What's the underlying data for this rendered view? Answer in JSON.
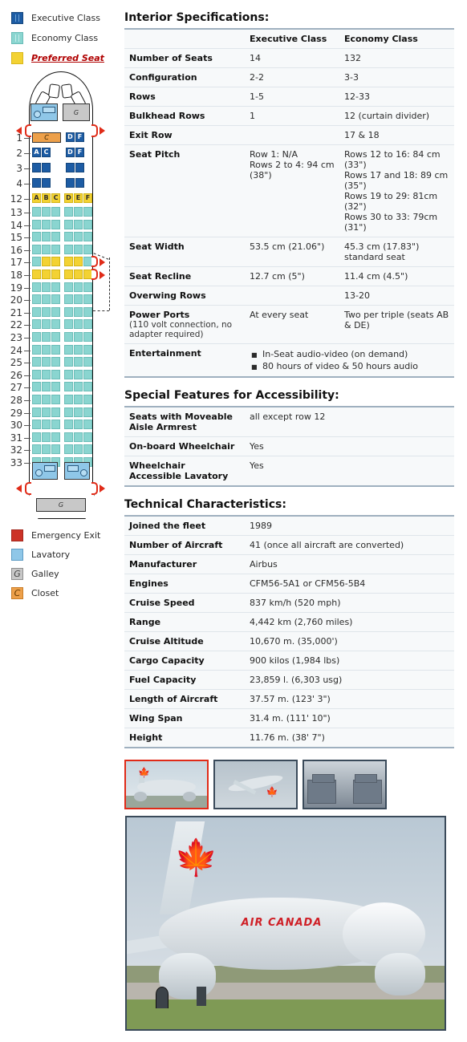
{
  "seatmap": {
    "legend_top": [
      {
        "key": "executive",
        "label": "Executive Class",
        "color": "#1d5ca4"
      },
      {
        "key": "economy",
        "label": "Economy Class",
        "color": "#8ad5d0"
      },
      {
        "key": "preferred",
        "label": "Preferred Seat",
        "color": "#f3d233"
      }
    ],
    "legend_bottom": [
      {
        "key": "emergency-exit",
        "label": "Emergency Exit",
        "color": "#cc3327",
        "glyph": ""
      },
      {
        "key": "lavatory",
        "label": "Lavatory",
        "color": "#8fc7e8",
        "glyph": ""
      },
      {
        "key": "galley",
        "label": "Galley",
        "color": "#c8c8c8",
        "glyph": "G"
      },
      {
        "key": "closet",
        "label": "Closet",
        "color": "#eda04a",
        "glyph": "C"
      }
    ],
    "front_lavatory_label": "",
    "front_galley_label": "G",
    "front_closet_label": "C",
    "rear_galley_label": "G",
    "seat_letters_left": "A B C",
    "seat_letters_right": "D E F",
    "rows": [
      {
        "num": "1",
        "class": "exec",
        "left": [
          "closet"
        ],
        "right": [
          "D",
          "F"
        ]
      },
      {
        "num": "2",
        "class": "exec",
        "left": [
          "A",
          "C"
        ],
        "right": [
          "D",
          "F"
        ]
      },
      {
        "num": "3",
        "class": "exec",
        "left": [
          "A",
          "C"
        ],
        "right": [
          "D",
          "F"
        ]
      },
      {
        "num": "4",
        "class": "exec",
        "left": [
          "A",
          "C"
        ],
        "right": [
          "D",
          "F"
        ]
      },
      {
        "num": "12",
        "class": "pref",
        "left": [
          "A",
          "B",
          "C"
        ],
        "right": [
          "D",
          "E",
          "F"
        ],
        "letters": true
      },
      {
        "num": "13",
        "class": "econ",
        "left": [
          "A",
          "B",
          "C"
        ],
        "right": [
          "D",
          "E",
          "F"
        ]
      },
      {
        "num": "14",
        "class": "econ",
        "left": [
          "A",
          "B",
          "C"
        ],
        "right": [
          "D",
          "E",
          "F"
        ]
      },
      {
        "num": "15",
        "class": "econ",
        "left": [
          "A",
          "B",
          "C"
        ],
        "right": [
          "D",
          "E",
          "F"
        ]
      },
      {
        "num": "16",
        "class": "econ",
        "left": [
          "A",
          "B",
          "C"
        ],
        "right": [
          "D",
          "E",
          "F"
        ]
      },
      {
        "num": "17",
        "class": "mixed",
        "left": [
          "A",
          "B",
          "C"
        ],
        "right": [
          "D",
          "E",
          "F"
        ],
        "exit": true
      },
      {
        "num": "18",
        "class": "pref",
        "left": [
          "A",
          "B",
          "C"
        ],
        "right": [
          "D",
          "E",
          "F"
        ],
        "exit": true
      },
      {
        "num": "19",
        "class": "econ",
        "left": [
          "A",
          "B",
          "C"
        ],
        "right": [
          "D",
          "E",
          "F"
        ]
      },
      {
        "num": "20",
        "class": "econ",
        "left": [
          "A",
          "B",
          "C"
        ],
        "right": [
          "D",
          "E",
          "F"
        ]
      },
      {
        "num": "21",
        "class": "econ",
        "left": [
          "A",
          "B",
          "C"
        ],
        "right": [
          "D",
          "E",
          "F"
        ]
      },
      {
        "num": "22",
        "class": "econ",
        "left": [
          "A",
          "B",
          "C"
        ],
        "right": [
          "D",
          "E",
          "F"
        ]
      },
      {
        "num": "23",
        "class": "econ",
        "left": [
          "A",
          "B",
          "C"
        ],
        "right": [
          "D",
          "E",
          "F"
        ]
      },
      {
        "num": "24",
        "class": "econ",
        "left": [
          "A",
          "B",
          "C"
        ],
        "right": [
          "D",
          "E",
          "F"
        ]
      },
      {
        "num": "25",
        "class": "econ",
        "left": [
          "A",
          "B",
          "C"
        ],
        "right": [
          "D",
          "E",
          "F"
        ]
      },
      {
        "num": "26",
        "class": "econ",
        "left": [
          "A",
          "B",
          "C"
        ],
        "right": [
          "D",
          "E",
          "F"
        ]
      },
      {
        "num": "27",
        "class": "econ",
        "left": [
          "A",
          "B",
          "C"
        ],
        "right": [
          "D",
          "E",
          "F"
        ]
      },
      {
        "num": "28",
        "class": "econ",
        "left": [
          "A",
          "B",
          "C"
        ],
        "right": [
          "D",
          "E",
          "F"
        ]
      },
      {
        "num": "29",
        "class": "econ",
        "left": [
          "A",
          "B",
          "C"
        ],
        "right": [
          "D",
          "E",
          "F"
        ]
      },
      {
        "num": "30",
        "class": "econ",
        "left": [
          "A",
          "B",
          "C"
        ],
        "right": [
          "D",
          "E",
          "F"
        ]
      },
      {
        "num": "31",
        "class": "econ",
        "left": [
          "A",
          "B",
          "C"
        ],
        "right": [
          "D",
          "E",
          "F"
        ]
      },
      {
        "num": "32",
        "class": "econ",
        "left": [
          "A",
          "B",
          "C"
        ],
        "right": [
          "D",
          "E",
          "F"
        ]
      },
      {
        "num": "33",
        "class": "econ",
        "left": [
          "A",
          "B",
          "C"
        ],
        "right": [
          "D",
          "E",
          "F"
        ]
      }
    ]
  },
  "interior": {
    "title": "Interior Specifications:",
    "col_exec": "Executive Class",
    "col_econ": "Economy Class",
    "rows": [
      {
        "label": "Number of Seats",
        "exec": "14",
        "econ": "132"
      },
      {
        "label": "Configuration",
        "exec": "2-2",
        "econ": "3-3"
      },
      {
        "label": "Rows",
        "exec": "1-5",
        "econ": "12-33"
      },
      {
        "label": "Bulkhead Rows",
        "exec": "1",
        "econ": "12 (curtain divider)"
      },
      {
        "label": "Exit Row",
        "exec": "",
        "econ": "17 & 18"
      },
      {
        "label": "Seat Pitch",
        "exec": "Row 1: N/A\nRows 2 to 4: 94 cm (38\")",
        "econ": "Rows 12 to 16: 84 cm (33\")\nRows 17 and 18: 89 cm (35\")\nRows 19 to 29: 81cm (32\")\nRows 30 to 33: 79cm (31\")"
      },
      {
        "label": "Seat Width",
        "exec": "53.5 cm (21.06\")",
        "econ": "45.3 cm (17.83\") standard seat"
      },
      {
        "label": "Seat Recline",
        "exec": "12.7 cm (5\")",
        "econ": "11.4 cm (4.5\")"
      },
      {
        "label": "Overwing Rows",
        "exec": "",
        "econ": "13-20"
      },
      {
        "label": "Power Ports",
        "label_sub": "(110 volt connection, no adapter required)",
        "exec": "At every seat",
        "econ": "Two per triple (seats AB & DE)"
      }
    ],
    "entertainment_label": "Entertainment",
    "entertainment_items": [
      "In-Seat audio-video (on demand)",
      "80 hours of video & 50 hours audio"
    ]
  },
  "accessibility": {
    "title": "Special Features for Accessibility:",
    "rows": [
      {
        "label": "Seats with Moveable Aisle Armrest",
        "value": "all except row 12"
      },
      {
        "label": "On-board Wheelchair",
        "value": "Yes"
      },
      {
        "label": "Wheelchair Accessible Lavatory",
        "value": "Yes"
      }
    ]
  },
  "technical": {
    "title": "Technical Characteristics:",
    "rows": [
      {
        "label": "Joined the fleet",
        "value": "1989"
      },
      {
        "label": "Number of Aircraft",
        "value": "41 (once all aircraft are converted)"
      },
      {
        "label": "Manufacturer",
        "value": "Airbus"
      },
      {
        "label": "Engines",
        "value": "CFM56-5A1 or CFM56-5B4"
      },
      {
        "label": "Cruise Speed",
        "value": "837 km/h (520 mph)"
      },
      {
        "label": "Range",
        "value": "4,442 km (2,760 miles)"
      },
      {
        "label": "Cruise Altitude",
        "value": "10,670 m. (35,000')"
      },
      {
        "label": "Cargo Capacity",
        "value": "900 kilos (1,984 lbs)"
      },
      {
        "label": "Fuel Capacity",
        "value": "23,859 l. (6,303 usg)"
      },
      {
        "label": "Length of Aircraft",
        "value": "37.57 m. (123' 3\")"
      },
      {
        "label": "Wing Span",
        "value": "31.4 m. (111' 10\")"
      },
      {
        "label": "Height",
        "value": "11.76 m. (38' 7\")"
      }
    ]
  },
  "gallery": {
    "thumbs": [
      {
        "name": "exterior-ground",
        "selected": true
      },
      {
        "name": "exterior-takeoff",
        "selected": false
      },
      {
        "name": "interior-cabin",
        "selected": false
      }
    ],
    "main_photo_title": "AIR CANADA"
  }
}
